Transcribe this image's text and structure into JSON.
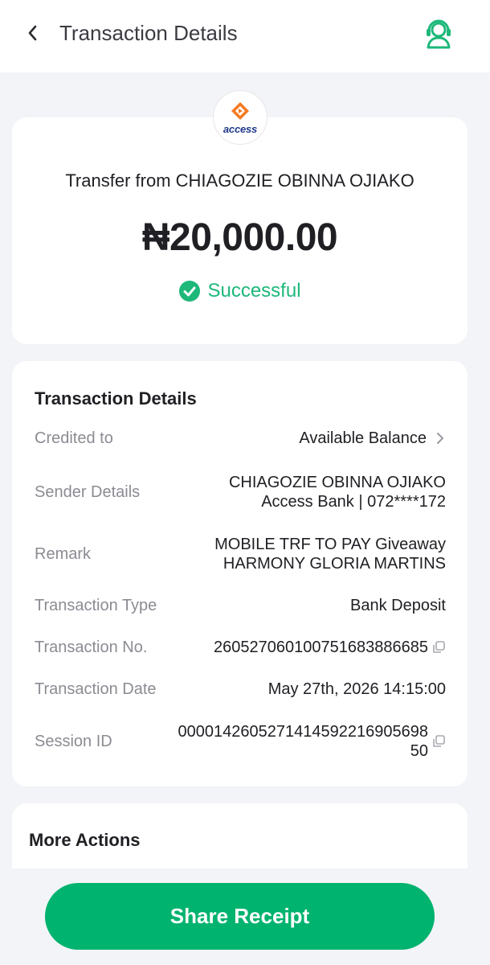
{
  "header": {
    "title": "Transaction Details",
    "back_icon": "chevron-left-icon",
    "support_icon": "customer-support-icon"
  },
  "summary": {
    "bank_logo_text": "access",
    "transfer_from": "Transfer from CHIAGOZIE OBINNA OJIAKO",
    "amount": "₦20,000.00",
    "status": "Successful",
    "status_color": "#1db87a"
  },
  "details": {
    "title": "Transaction Details",
    "credited_to": {
      "label": "Credited to",
      "value": "Available Balance"
    },
    "sender": {
      "label": "Sender Details",
      "line1": "CHIAGOZIE OBINNA OJIAKO",
      "line2": "Access Bank | 072****172"
    },
    "remark": {
      "label": "Remark",
      "line1": "MOBILE TRF TO PAY Giveaway",
      "line2": "HARMONY GLORIA MARTINS"
    },
    "type": {
      "label": "Transaction Type",
      "value": "Bank Deposit"
    },
    "number": {
      "label": "Transaction No.",
      "value": "260527060100751683886685"
    },
    "date": {
      "label": "Transaction Date",
      "value": "May 27th, 2026 14:15:00"
    },
    "session": {
      "label": "Session ID",
      "line1": "000014260527141459221690569 8",
      "line1_exact": "0000142605271414592216905698",
      "line2": "50"
    }
  },
  "more_actions": {
    "title": "More Actions"
  },
  "share_button": {
    "label": "Share Receipt",
    "color": "#00b36e"
  }
}
